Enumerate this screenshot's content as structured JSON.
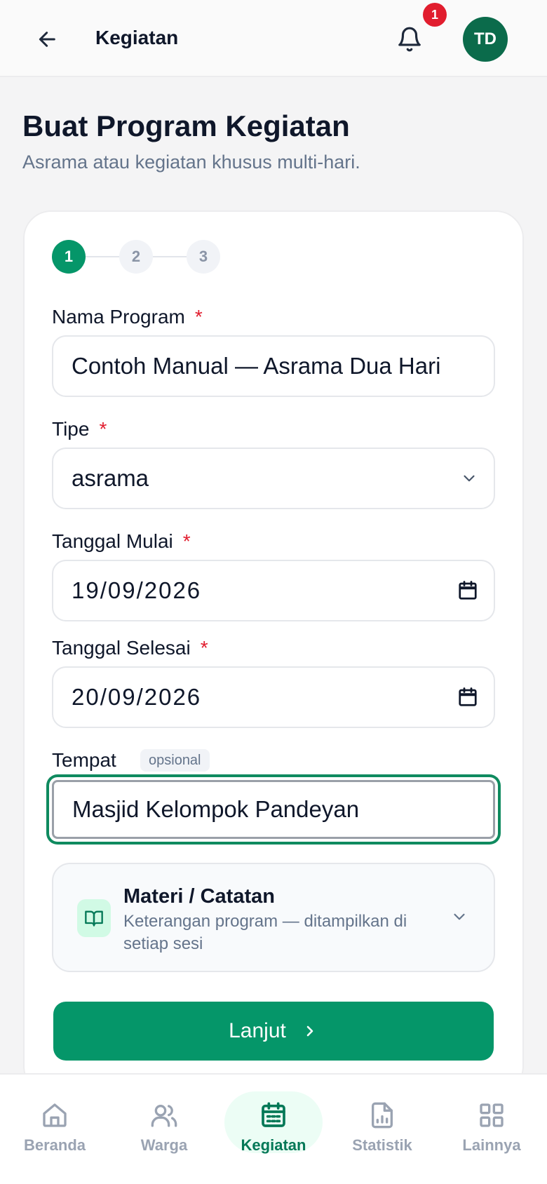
{
  "header": {
    "title": "Kegiatan",
    "notification_count": "1",
    "avatar_initials": "TD"
  },
  "page": {
    "title": "Buat Program Kegiatan",
    "subtitle": "Asrama atau kegiatan khusus multi-hari."
  },
  "stepper": {
    "steps": [
      "1",
      "2",
      "3"
    ],
    "current": 1
  },
  "form": {
    "nama_program": {
      "label": "Nama Program",
      "required_mark": "*",
      "value": "Contoh Manual — Asrama Dua Hari"
    },
    "tipe": {
      "label": "Tipe",
      "required_mark": "*",
      "value": "asrama"
    },
    "tanggal_mulai": {
      "label": "Tanggal Mulai",
      "required_mark": "*",
      "value": "19/09/2026"
    },
    "tanggal_selesai": {
      "label": "Tanggal Selesai",
      "required_mark": "*",
      "value": "20/09/2026"
    },
    "tempat": {
      "label": "Tempat",
      "optional_tag": "opsional",
      "value": "Masjid Kelompok Pandeyan"
    },
    "materi": {
      "title": "Materi / Catatan",
      "description": "Keterangan program — ditampilkan di setiap sesi"
    },
    "submit_label": "Lanjut"
  },
  "bottom_nav": {
    "items": [
      {
        "label": "Beranda",
        "icon": "home-icon"
      },
      {
        "label": "Warga",
        "icon": "users-icon"
      },
      {
        "label": "Kegiatan",
        "icon": "calendar-icon",
        "active": true
      },
      {
        "label": "Statistik",
        "icon": "report-icon"
      },
      {
        "label": "Lainnya",
        "icon": "grid-icon"
      }
    ]
  },
  "colors": {
    "primary": "#059669",
    "avatar": "#0b6b4b",
    "badge": "#e11d2e",
    "required": "#e11d2e"
  }
}
